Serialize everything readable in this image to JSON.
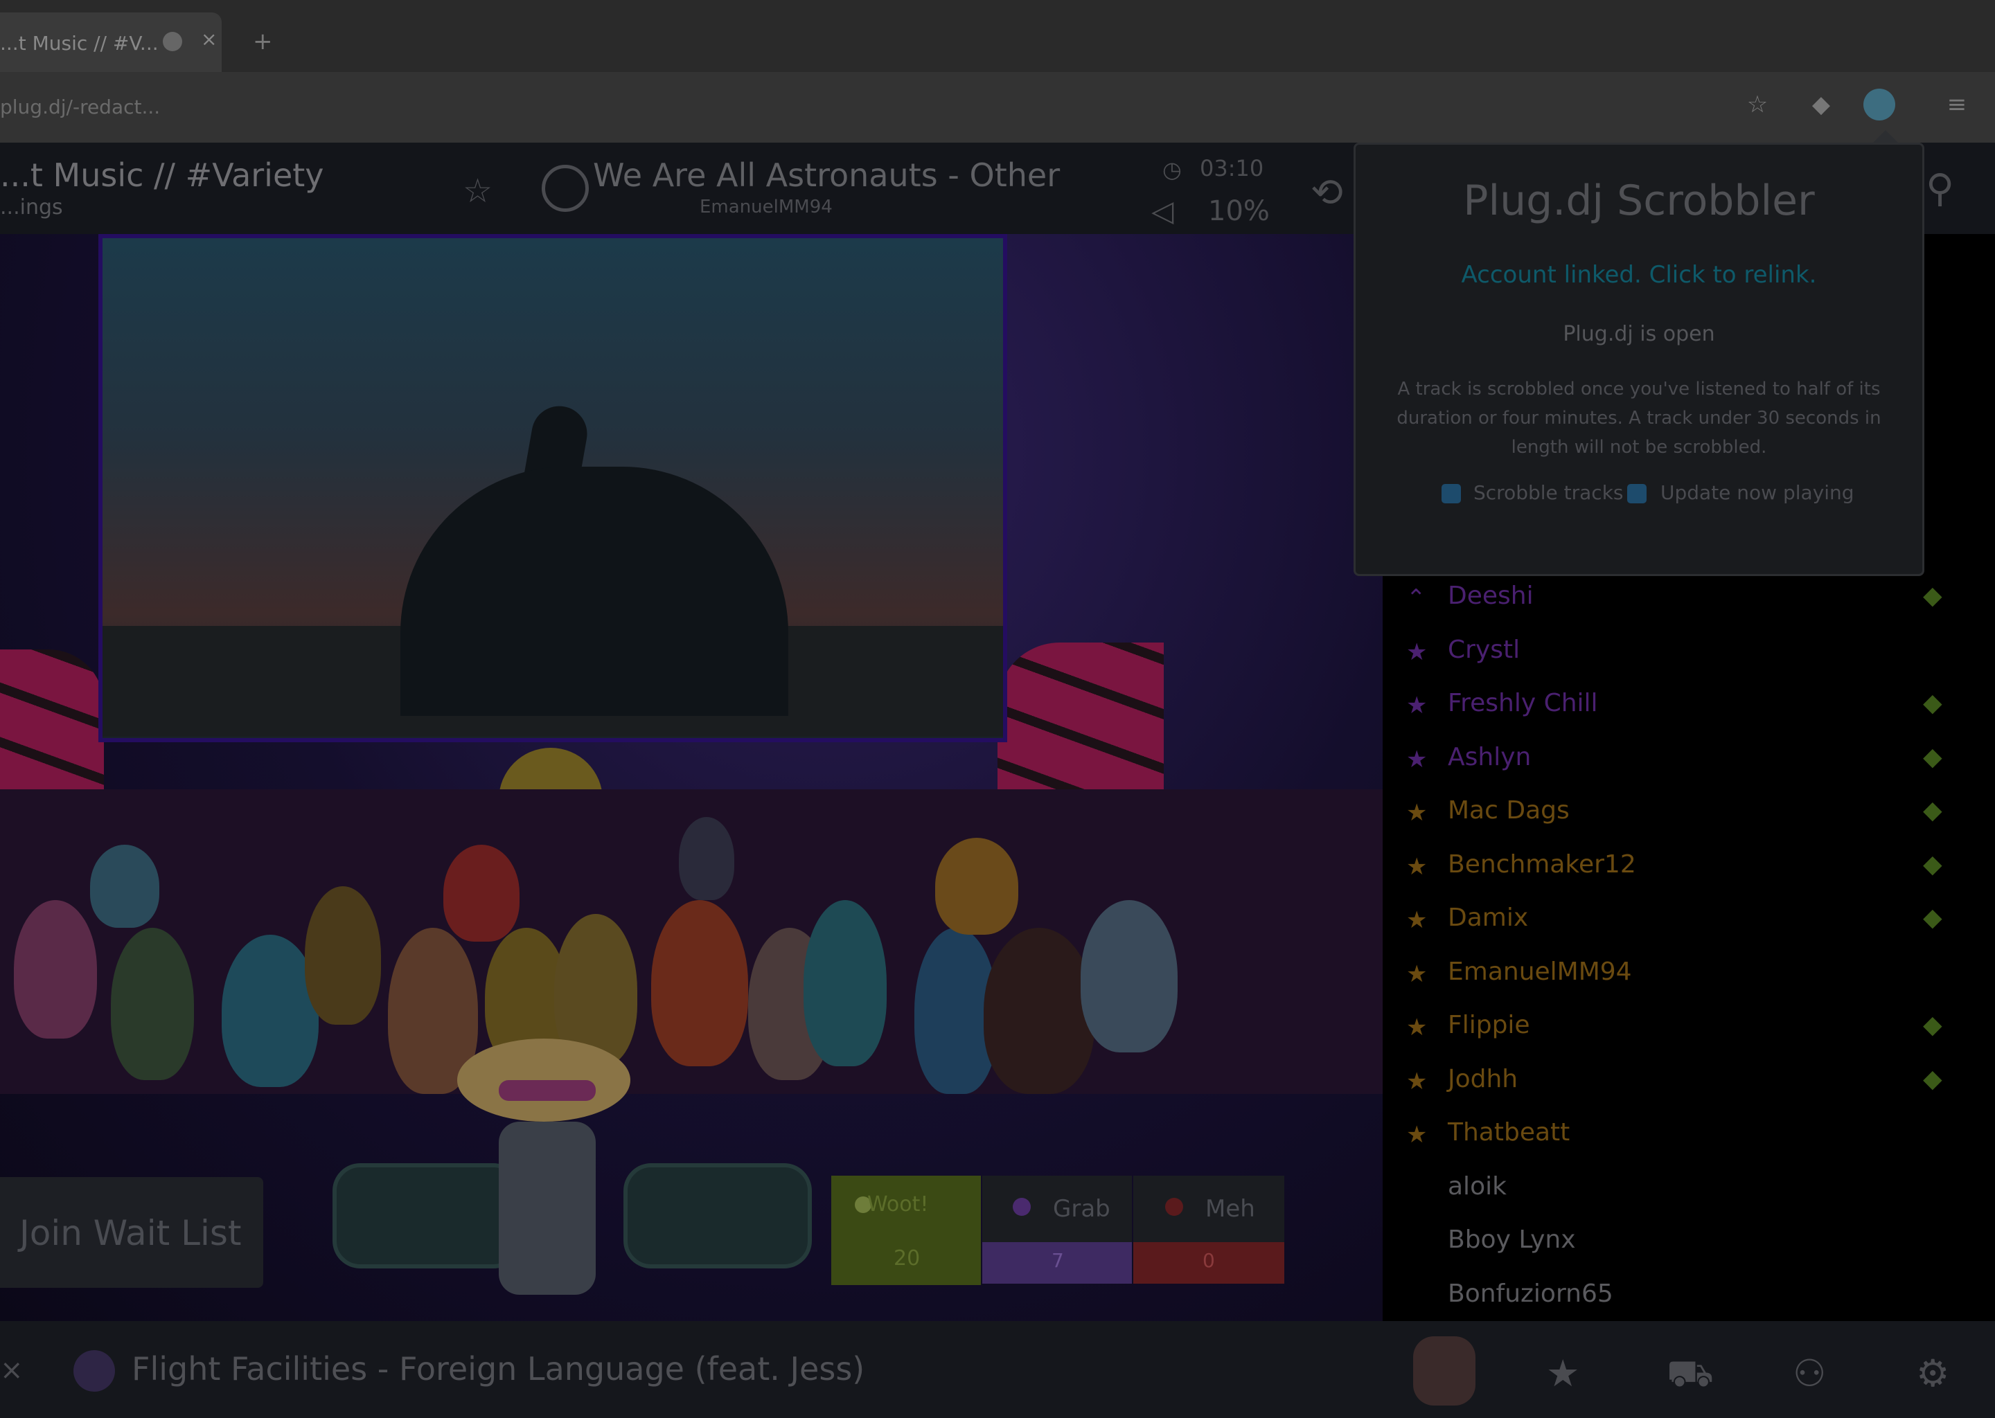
{
  "browser": {
    "tab_title": "...t Music // #V...",
    "tab_close": "×",
    "new_tab": "+",
    "address": "plug.dj/-redact..."
  },
  "header": {
    "room_title": "...t Music // #Variety",
    "room_sub": "...ings",
    "now_playing": "We Are All Astronauts - Other",
    "now_playing_dj": "EmanuelMM94",
    "time": "03:10",
    "volume": "10%"
  },
  "waitlist": {
    "label": "Join Wait List"
  },
  "votes": {
    "woot_label": "Woot!",
    "woot_count": "20",
    "grab_label": "Grab",
    "grab_count": "7",
    "meh_label": "Meh",
    "meh_count": "0"
  },
  "bottom": {
    "track": "Flight Facilities - Foreign Language (feat. Jess)"
  },
  "userlist": {
    "rows": [
      {
        "name": "Deeshi",
        "icon": "chevron-icon",
        "color": "#4a2070",
        "check": true
      },
      {
        "name": "Crystl",
        "icon": "star-icon",
        "color": "#4a2070",
        "check": false
      },
      {
        "name": "Freshly Chill",
        "icon": "star-icon",
        "color": "#4a2070",
        "check": true
      },
      {
        "name": "Ashlyn",
        "icon": "star-icon",
        "color": "#4a2070",
        "check": true
      },
      {
        "name": "Mac Dags",
        "icon": "star-icon",
        "color": "#6a4a10",
        "check": true
      },
      {
        "name": "Benchmaker12",
        "icon": "star-icon",
        "color": "#6a4a10",
        "check": true
      },
      {
        "name": "Damix",
        "icon": "star-icon",
        "color": "#6a4a10",
        "check": true
      },
      {
        "name": "EmanuelMM94",
        "icon": "star-icon",
        "color": "#6a4a10",
        "check": false
      },
      {
        "name": "Flippie",
        "icon": "star-icon",
        "color": "#6a4a10",
        "check": true
      },
      {
        "name": "Jodhh",
        "icon": "star-icon",
        "color": "#6a4a10",
        "check": true
      },
      {
        "name": "Thatbeatt",
        "icon": "star-icon",
        "color": "#6a4a10",
        "check": false
      },
      {
        "name": "aloik",
        "icon": "",
        "color": "#5a5a5e",
        "check": false
      },
      {
        "name": "Bboy Lynx",
        "icon": "",
        "color": "#5a5a5e",
        "check": false
      },
      {
        "name": "Bonfuziorn65",
        "icon": "",
        "color": "#5a5a5e",
        "check": false
      }
    ]
  },
  "popup": {
    "title": "Plug.dj Scrobbler",
    "link": "Account linked. Click to relink.",
    "status": "Plug.dj is open",
    "description": "A track is scrobbled once you've listened to half of its duration or four minutes. A track under 30 seconds in length will not be scrobbled.",
    "opt_scrobble": "Scrobble tracks",
    "opt_nowplaying": "Update now playing"
  },
  "colors": {
    "accent_link": "#0e5a6a",
    "woot": "#3b4a14",
    "grab": "#3e2a62",
    "meh": "#5a1a1c"
  }
}
